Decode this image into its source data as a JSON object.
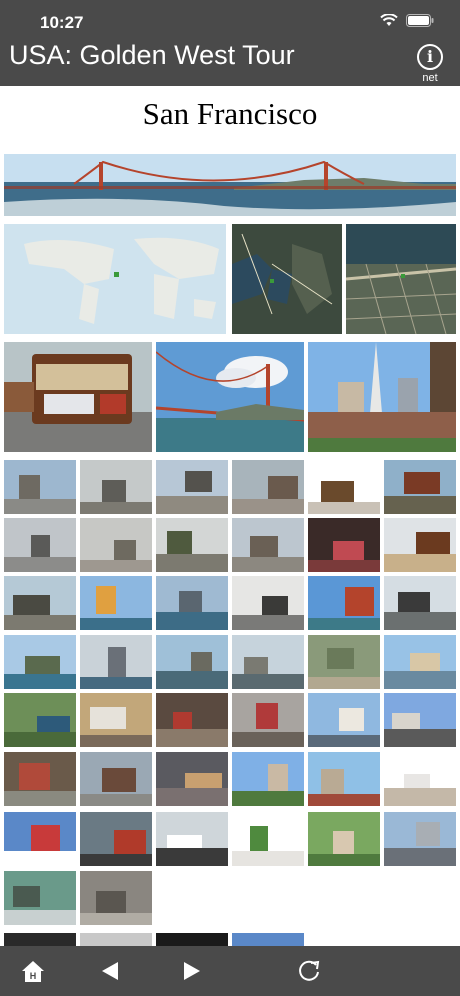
{
  "status": {
    "time": "10:27"
  },
  "header": {
    "title": "USA: Golden West Tour",
    "info_label": "net"
  },
  "content": {
    "title": "San Francisco"
  },
  "tiles": [
    {
      "name": "photo-golden-gate-panorama",
      "kind": "photo"
    },
    {
      "name": "map-world",
      "kind": "map"
    },
    {
      "name": "map-bay-area",
      "kind": "map"
    },
    {
      "name": "map-street",
      "kind": "map"
    },
    {
      "name": "photo-cable-car",
      "kind": "photo"
    },
    {
      "name": "photo-golden-gate-bridge",
      "kind": "photo"
    },
    {
      "name": "photo-transamerica-skyline",
      "kind": "photo"
    }
  ],
  "toolbar": {
    "home": "home-icon",
    "back": "back-arrow-icon",
    "forward": "forward-arrow-icon",
    "reload": "reload-icon"
  }
}
